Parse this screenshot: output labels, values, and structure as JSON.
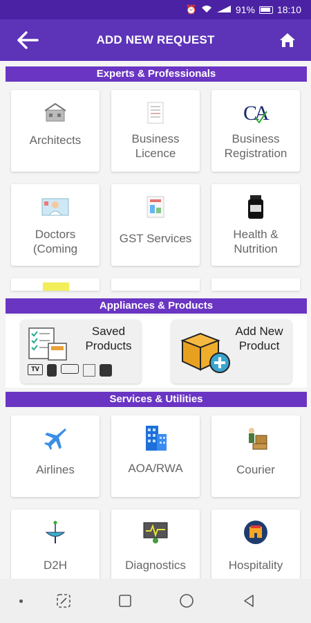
{
  "status_bar": {
    "battery": "91%",
    "time": "18:10"
  },
  "app_bar": {
    "title": "ADD NEW REQUEST"
  },
  "sections": {
    "experts": {
      "title": "Experts & Professionals",
      "items": [
        {
          "label": "Architects",
          "icon": "building-sketch-icon"
        },
        {
          "label": "Business\nLicence",
          "icon": "license-document-icon"
        },
        {
          "label": "Business\nRegistration",
          "icon": "ca-logo-icon"
        },
        {
          "label": "Doctors\n(Coming",
          "icon": "doctor-icon"
        },
        {
          "label": "GST Services",
          "icon": "gst-document-icon"
        },
        {
          "label": "Health &\nNutrition",
          "icon": "supplement-jar-icon"
        }
      ]
    },
    "appliances": {
      "title": "Appliances & Products",
      "saved_label": "Saved\nProducts",
      "add_label": "Add New\nProduct"
    },
    "services": {
      "title": "Services & Utilities",
      "items": [
        {
          "label": "Airlines",
          "icon": "airplane-icon"
        },
        {
          "label": "AOA/RWA",
          "icon": "buildings-icon"
        },
        {
          "label": "Courier",
          "icon": "courier-icon"
        },
        {
          "label": "D2H",
          "icon": "satellite-dish-icon"
        },
        {
          "label": "Diagnostics",
          "icon": "diagnostics-icon"
        },
        {
          "label": "Hospitality",
          "icon": "hotel-icon"
        }
      ]
    }
  },
  "colors": {
    "status_bar": "#4a22a3",
    "app_bar": "#5d33b8",
    "section_header": "#6a35c3"
  }
}
